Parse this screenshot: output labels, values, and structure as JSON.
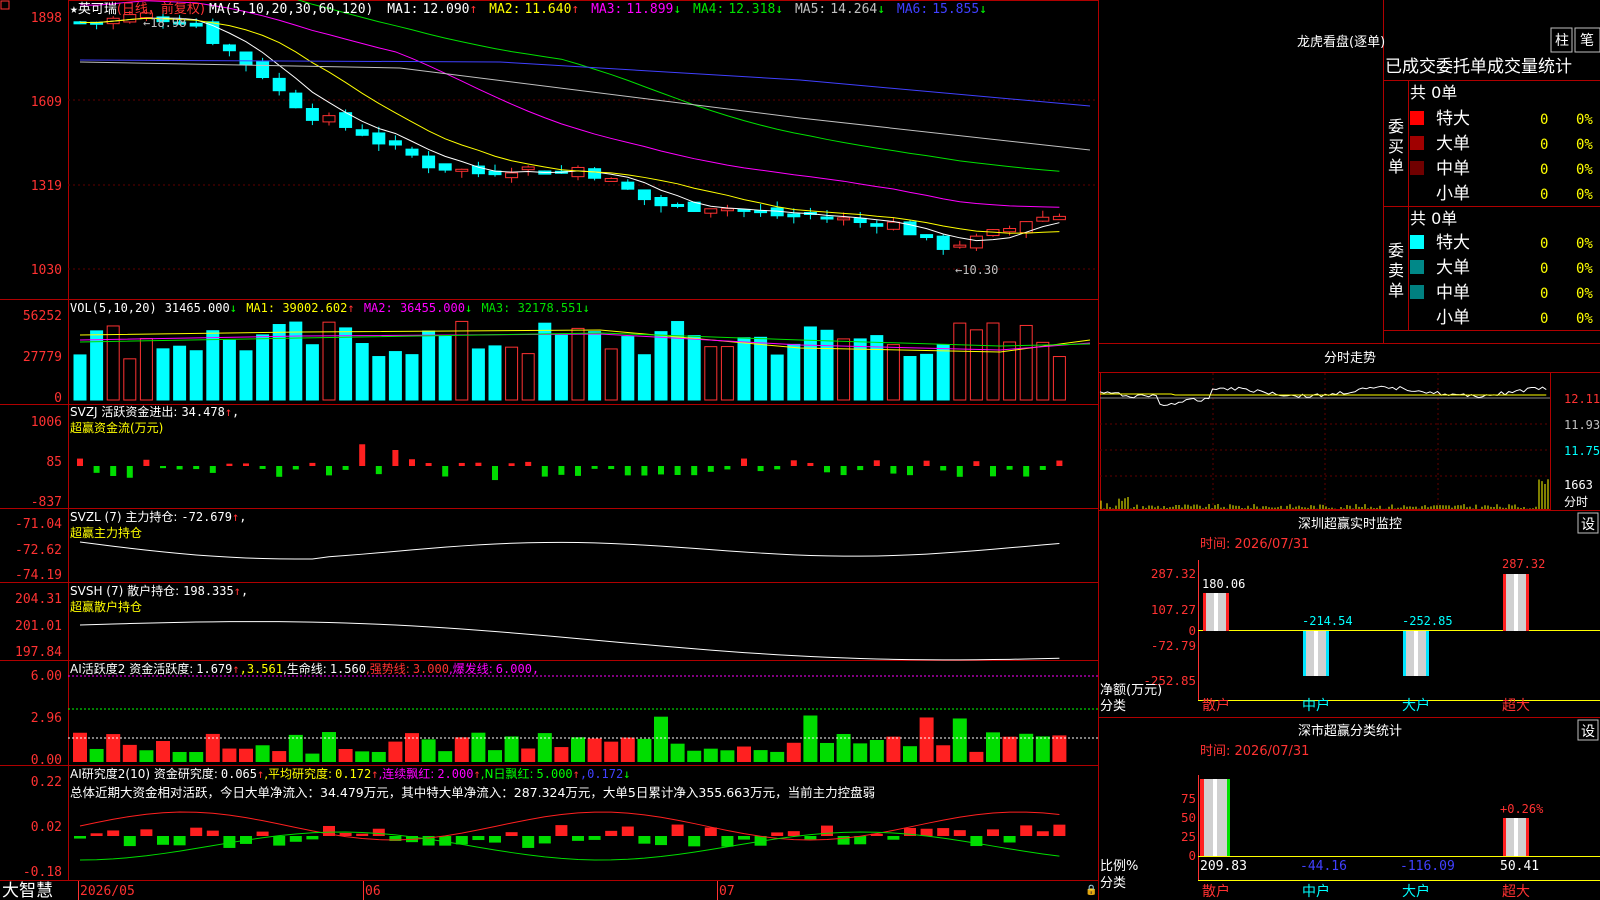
{
  "stock": {
    "name": "英可瑞",
    "mode": "(日线，前复权)",
    "marker": "★"
  },
  "colors": {
    "up": "#ff3232",
    "down": "#00ffff",
    "grid": "#b00000",
    "axis": "#ff3232",
    "ma1": "#ffffff",
    "ma2": "#ffff00",
    "ma3": "#ff00ff",
    "ma4": "#00e000",
    "ma5": "#c0c0c0",
    "ma6": "#4040ff"
  },
  "main": {
    "ma_label": "MA(5,10,20,30,60,120)",
    "ma1": {
      "label": "MA1:",
      "value": "12.090",
      "arrow": "↑"
    },
    "ma2": {
      "label": "MA2:",
      "value": "11.640",
      "arrow": "↑"
    },
    "ma3": {
      "label": "MA3:",
      "value": "11.899",
      "arrow": "↓"
    },
    "ma4": {
      "label": "MA4:",
      "value": "12.318",
      "arrow": "↓"
    },
    "ma5": {
      "label": "MA5:",
      "value": "14.264",
      "arrow": "↓"
    },
    "ma6": {
      "label": "MA6:",
      "value": "15.855",
      "arrow": "↓"
    },
    "yticks": [
      "1898",
      "1609",
      "1319",
      "1030"
    ],
    "high_mark": "18.98",
    "low_mark": "←10.30"
  },
  "vol": {
    "label": "VOL(5,10,20)",
    "value": "31465.000",
    "arrow": "↓",
    "ma1": "MA1: 39002.602",
    "ma1_arrow": "↑",
    "ma2": "MA2: 36455.000",
    "ma2_arrow": "↓",
    "ma3": "MA3: 32178.551",
    "ma3_arrow": "↓",
    "yticks": [
      "56252",
      "27779",
      "0"
    ]
  },
  "svzj": {
    "label": "SVZJ  活跃资金进出:",
    "value": "34.478",
    "arrow": "↑",
    "sub": "超赢资金流(万元)",
    "yticks": [
      "1006",
      "85",
      "-837"
    ]
  },
  "svzl": {
    "label": "SVZL (7) 主力持仓:",
    "value": "-72.679",
    "arrow": "↑",
    "sub": "超赢主力持仓",
    "yticks": [
      "-71.04",
      "-72.62",
      "-74.19"
    ]
  },
  "svsh": {
    "label": "SVSH (7) 散户持仓:",
    "value": "198.335",
    "arrow": "↑",
    "sub": "超赢散户持仓",
    "yticks": [
      "204.31",
      "201.01",
      "197.84"
    ]
  },
  "ai1": {
    "label": "AI活跃度2 资金活跃度:",
    "v1": "1.679",
    "a1": "↑",
    "v2": ",3.561",
    "life": ",生命线:",
    "v3": "1.560",
    "strong": ",强势线:",
    "v4": "3.000",
    "burst": ",爆发线:",
    "v5": "6.000",
    "tail": ",",
    "yticks": [
      "6.00",
      "2.96",
      "0.00"
    ]
  },
  "ai2": {
    "label": "AI研究度2(10) 资金研究度:",
    "v1": "0.065",
    "a1": "↑",
    "avg": ",平均研究度:",
    "v2": "0.172",
    "a2": "↑",
    "cont": ",连续飘红:",
    "v3": "2.000",
    "a3": "↑",
    "nday": ",N日飘红:",
    "v4": "5.000",
    "a4": "↑",
    "v5": ",0.172",
    "a5": "↓",
    "summary": "总体近期大资金相对活跃，今日大单净流入：34.479万元，其中特大单净流入：287.324万元，大单5日累计净入355.663万元，当前主力控盘弱",
    "yticks": [
      "0.22",
      "0.02",
      "-0.18"
    ]
  },
  "xaxis": {
    "brand": "大智慧",
    "labels": [
      "2026/05",
      "06",
      "07"
    ]
  },
  "lhb": {
    "title": "龙虎看盘(逐单)",
    "btn_zhu": "柱",
    "btn_bi": "笔",
    "header": "已成交委托单成交量统计",
    "buy_label": "委买单",
    "sell_label": "委卖单",
    "buy_total": "共 0单",
    "sell_total": "共 0单",
    "buy_rows": [
      {
        "name": "特大",
        "count": "0",
        "pct": "0%",
        "color": "#ff0000"
      },
      {
        "name": "大单",
        "count": "0",
        "pct": "0%",
        "color": "#a00000"
      },
      {
        "name": "中单",
        "count": "0",
        "pct": "0%",
        "color": "#700000"
      },
      {
        "name": "小单",
        "count": "0",
        "pct": "0%",
        "color": "#000000"
      }
    ],
    "sell_rows": [
      {
        "name": "特大",
        "count": "0",
        "pct": "0%",
        "color": "#00ffff"
      },
      {
        "name": "大单",
        "count": "0",
        "pct": "0%",
        "color": "#008888"
      },
      {
        "name": "中单",
        "count": "0",
        "pct": "0%",
        "color": "#008080"
      },
      {
        "name": "小单",
        "count": "0",
        "pct": "0%",
        "color": "#000000"
      }
    ]
  },
  "intraday": {
    "title": "分时走势",
    "prices": [
      "12.11",
      "11.93",
      "11.75"
    ],
    "vol": "1663",
    "vol_label": "分时"
  },
  "monitor": {
    "title": "深圳超赢实时监控",
    "btn": "设",
    "date": "时间: 2026/07/31",
    "yticks": [
      "287.32",
      "107.27",
      "0",
      "-72.79",
      "-252.85"
    ],
    "ylabel1": "净额(万元)",
    "ylabel2": "分类",
    "cats": [
      "散户",
      "中户",
      "大户",
      "超大"
    ],
    "values": [
      "180.06",
      "-214.54",
      "-252.85",
      "287.32"
    ]
  },
  "classify": {
    "title": "深市超赢分类统计",
    "btn": "设",
    "date": "时间: 2026/07/31",
    "yticks": [
      "75",
      "50",
      "25",
      "0"
    ],
    "ylabel1": "比例%",
    "ylabel2": "分类",
    "cats": [
      "散户",
      "中户",
      "大户",
      "超大"
    ],
    "values": [
      "209.83",
      "-44.16",
      "-116.09",
      "50.41"
    ],
    "pct_label": "+0.26%"
  }
}
